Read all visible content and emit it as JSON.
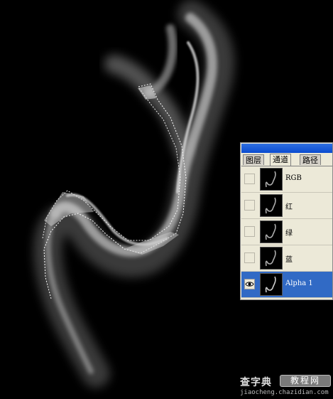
{
  "panel": {
    "tabs": [
      {
        "label": "图层",
        "active": false
      },
      {
        "label": "通道",
        "active": true
      },
      {
        "label": "路径",
        "active": false
      }
    ],
    "channels": [
      {
        "label": "RGB",
        "visible": false,
        "selected": false
      },
      {
        "label": "红",
        "visible": false,
        "selected": false
      },
      {
        "label": "绿",
        "visible": false,
        "selected": false
      },
      {
        "label": "蓝",
        "visible": false,
        "selected": false
      },
      {
        "label": "Alpha 1",
        "visible": true,
        "selected": true
      }
    ],
    "icons": {
      "visibility": "eye-icon",
      "thumbnail": "smoke-thumbnail"
    },
    "colors": {
      "selected_row": "#316ac5",
      "titlebar": "#0a4bd0"
    }
  },
  "watermark": {
    "brand": "查字典",
    "tag": "教程网",
    "url": "jiaocheng.chazidian.com"
  }
}
